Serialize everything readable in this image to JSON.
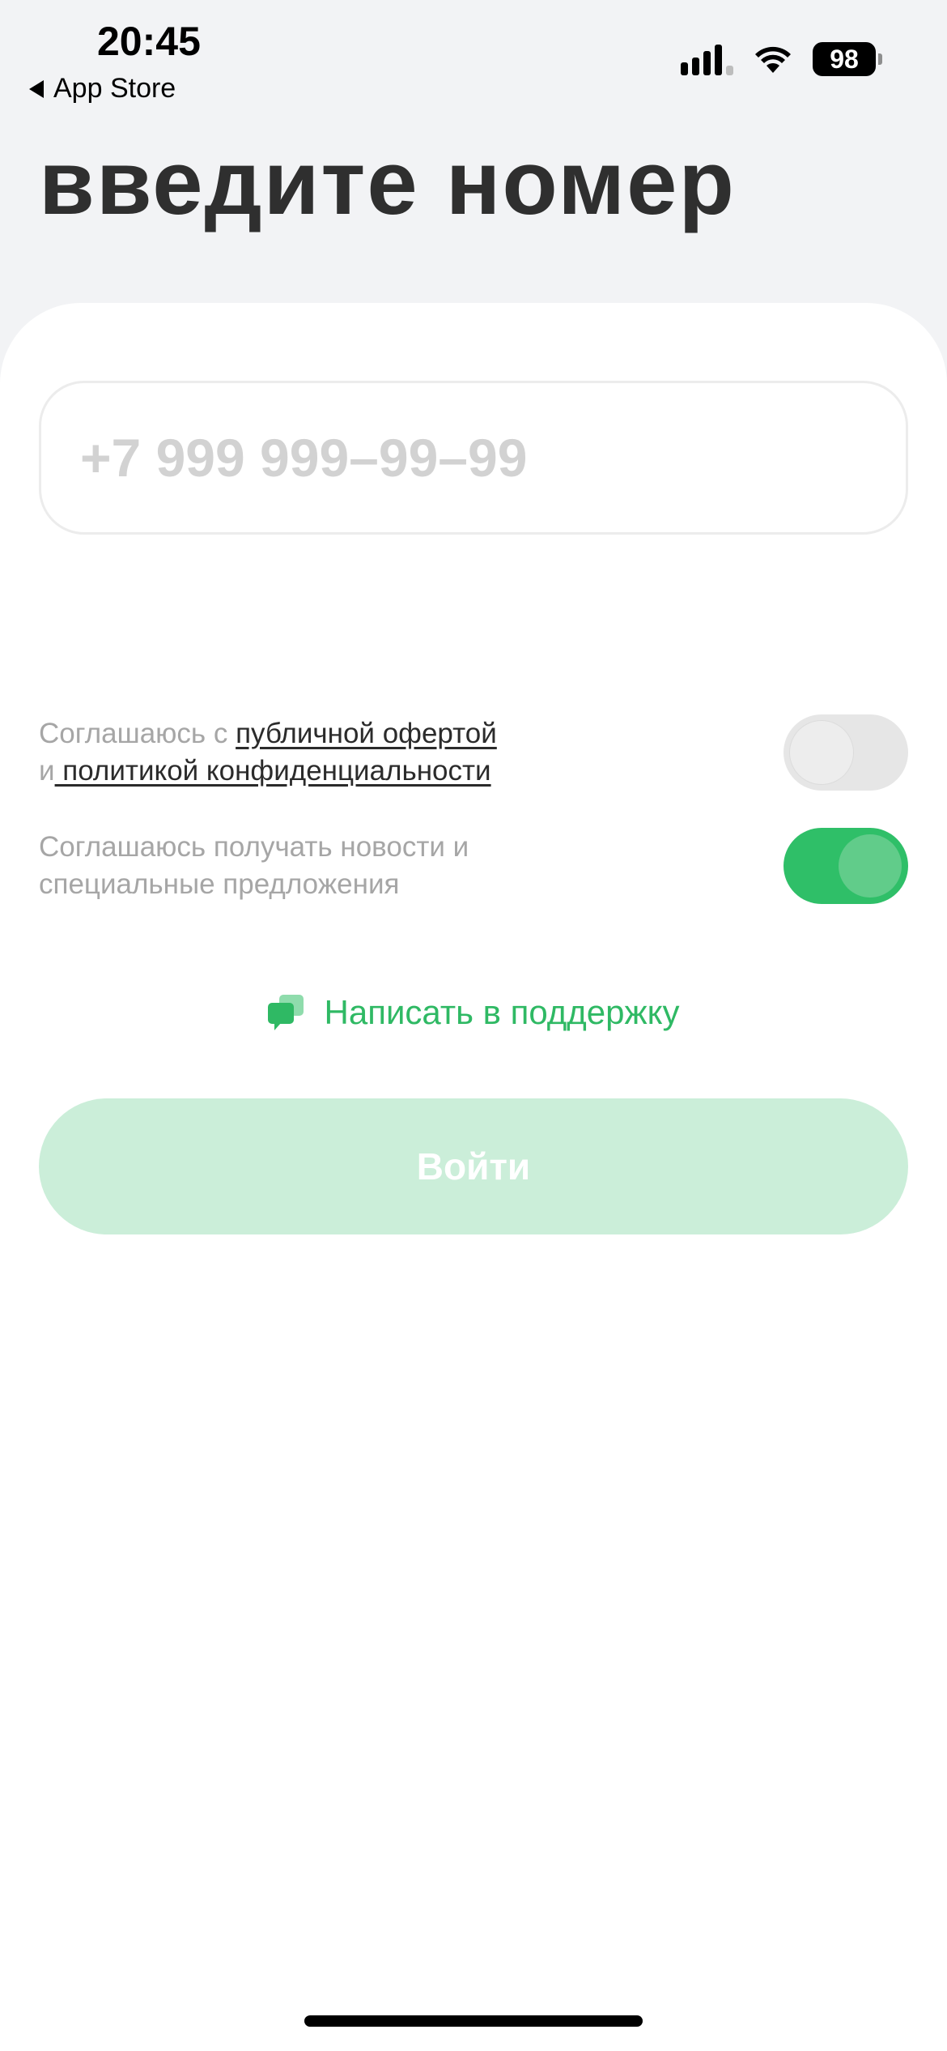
{
  "status_bar": {
    "time": "20:45",
    "back_label": "App Store",
    "battery": "98"
  },
  "header": {
    "title": "Введите номер"
  },
  "phone_input": {
    "placeholder": "+7 999 999–99–99",
    "value": ""
  },
  "consents": {
    "offer": {
      "prefix": "Соглашаюсь с ",
      "link_offer": "публичной офертой",
      "middle": "и",
      "link_policy": " политикой конфиденциальности",
      "checked": false
    },
    "news": {
      "text": "Соглашаюсь получать новости и специальные предложения",
      "checked": true
    }
  },
  "support": {
    "label": "Написать в поддержку",
    "icon": "chat-bubbles-icon"
  },
  "login_button": {
    "label": "Войти",
    "enabled": false
  },
  "colors": {
    "accent": "#2fbf68",
    "button_disabled": "#cbeed9",
    "background": "#f2f3f5",
    "title": "#2f2f2f"
  }
}
